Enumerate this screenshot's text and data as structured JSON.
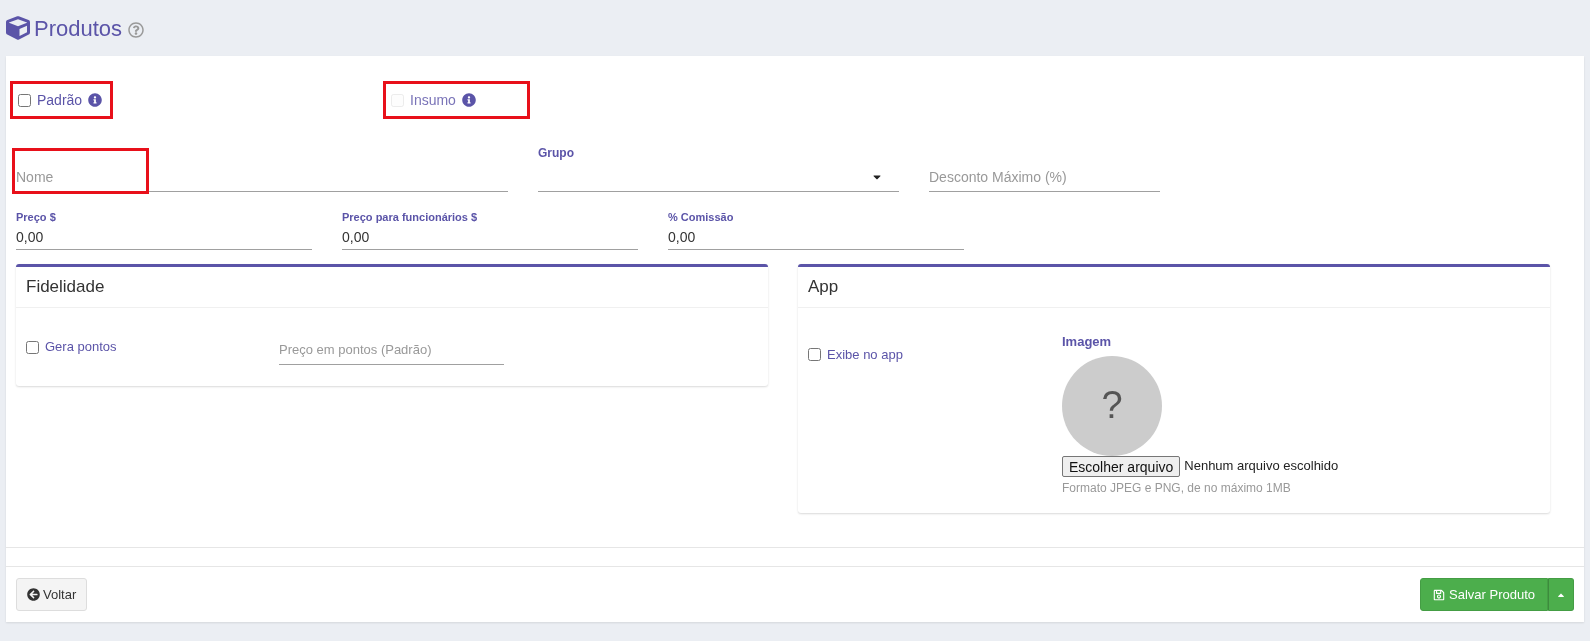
{
  "header": {
    "title": "Produtos"
  },
  "flags": [
    {
      "label": "Padrão",
      "checked": false,
      "disabled": false,
      "highlighted": true
    },
    {
      "label": "Insumo",
      "checked": false,
      "disabled": true,
      "highlighted": true
    }
  ],
  "fields_row1": [
    {
      "kind": "text",
      "placeholder": "Nome",
      "highlighted": true
    },
    {
      "kind": "select",
      "label": "Grupo"
    },
    {
      "kind": "text",
      "placeholder": "Desconto Máximo (%)",
      "highlighted": false
    }
  ],
  "fields_row2": [
    {
      "label": "Preço $",
      "value": "0,00"
    },
    {
      "label": "Preço para funcionários $",
      "value": "0,00"
    },
    {
      "label": "% Comissão",
      "value": "0,00"
    }
  ],
  "fidelidade": {
    "title": "Fidelidade",
    "checkbox": {
      "label": "Gera pontos",
      "checked": false
    },
    "field": {
      "placeholder": "Preço em pontos (Padrão)"
    }
  },
  "app": {
    "title": "App",
    "checkbox": {
      "label": "Exibe no app",
      "checked": false
    },
    "image": {
      "label": "Imagem",
      "glyph": "?",
      "file_button": "Escolher arquivo",
      "file_status": "Nenhum arquivo escolhido",
      "hint": "Formato JPEG e PNG, de no máximo 1MB"
    }
  },
  "footer": {
    "back": "Voltar",
    "save": "Salvar Produto"
  }
}
